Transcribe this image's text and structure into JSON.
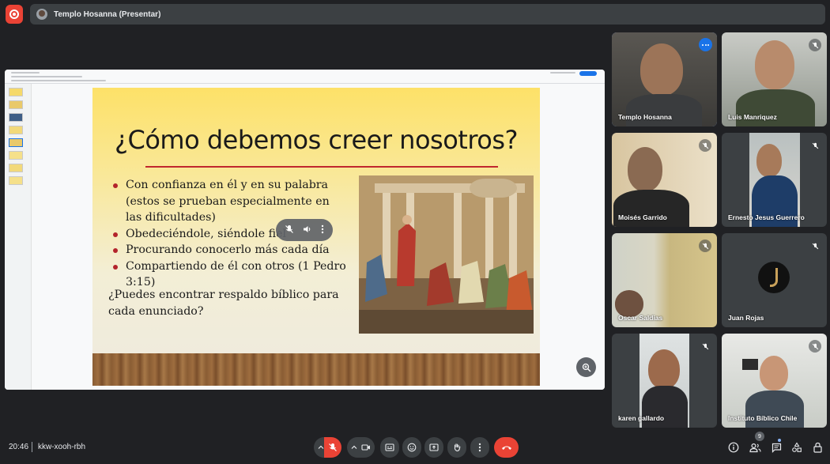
{
  "meeting": {
    "presenting_label": "Templo Hosanna (Presentar)",
    "time": "20:46",
    "code": "kkw-xooh-rbh",
    "people_count": "9"
  },
  "slide": {
    "title": "¿Cómo debemos creer nosotros?",
    "bullets": [
      "Con confianza en él y en su palabra (estos se prueban especialmente en las dificultades)",
      "Obedeciéndole, siéndole fiel",
      "Procurando conocerlo más cada día",
      "Compartiendo de él con otros (1 Pedro 3:15)"
    ],
    "question": "¿Puedes encontrar respaldo bíblico para cada enunciado?"
  },
  "participants": [
    {
      "name": "Templo Hosanna"
    },
    {
      "name": "Luis Manriquez"
    },
    {
      "name": "Moisés Garrido"
    },
    {
      "name": "Ernesto Jesus Guerrero"
    },
    {
      "name": "Oscar Saldias"
    },
    {
      "name": "Juan Rojas"
    },
    {
      "name": "karen gallardo"
    },
    {
      "name": "Instituto Bíblico Chile"
    }
  ],
  "colors": {
    "background": "#202124",
    "bar": "#3c4043",
    "danger": "#ea4335",
    "accent": "#1a73e8",
    "active_outline": "#8ab4f8"
  },
  "icons": {
    "record": "record-icon",
    "mic": "mic-off-icon",
    "camera": "camera-icon",
    "captions": "captions-icon",
    "emoji": "emoji-icon",
    "present": "present-screen-icon",
    "hand": "raise-hand-icon",
    "more": "more-vert-icon",
    "end": "end-call-icon",
    "info": "info-icon",
    "people": "people-icon",
    "chat": "chat-icon",
    "activities": "activities-icon",
    "lock": "host-controls-lock-icon",
    "zoom": "zoom-in-icon"
  }
}
